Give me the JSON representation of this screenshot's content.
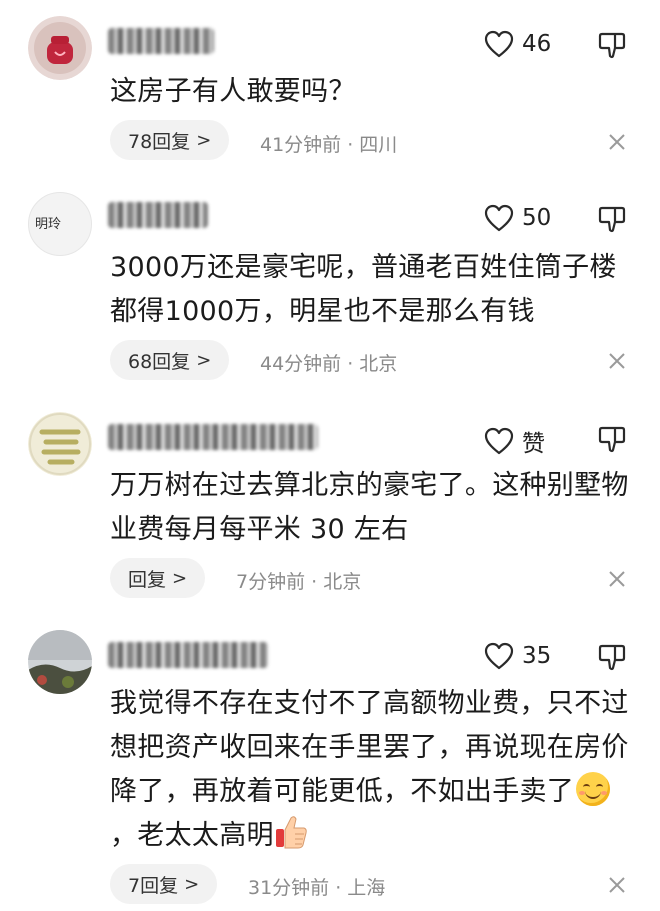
{
  "comments": [
    {
      "text": "这房子有人敢要吗？",
      "like_count": "46",
      "reply_label": "78回复",
      "time_location": "41分钟前 · 四川"
    },
    {
      "avatar_text": "明玲",
      "text": "3000万还是豪宅呢，普通老百姓住筒子楼都得1000万，明星也不是那么有钱",
      "like_count": "50",
      "reply_label": "68回复",
      "time_location": "44分钟前 · 北京"
    },
    {
      "text": "万万树在过去算北京的豪宅了。这种别墅物业费每月每平米 30 左右",
      "like_count": "赞",
      "reply_label": "回复",
      "time_location": "7分钟前 · 北京"
    },
    {
      "text_part1": "我觉得不存在支付不了高额物业费，只不过想把资产收回来在手里罢了，再说现在房价降了，再放着可能更低，不如出手卖了",
      "text_part2": "，老太太高明",
      "like_count": "35",
      "reply_label": "7回复",
      "time_location": "31分钟前 · 上海"
    }
  ],
  "reply_chevron": ">",
  "icons": {
    "like": "heart-outline-icon",
    "dislike": "thumbs-down-outline-icon",
    "close": "close-x-icon",
    "emoji_smile": "smiling-face-emoji",
    "emoji_thumb": "thumbs-up-emoji"
  },
  "colors": {
    "text": "#1b1b1b",
    "meta": "#8a8a8a",
    "reply_bg": "#f2f2f2",
    "close": "#9a9a9a"
  }
}
